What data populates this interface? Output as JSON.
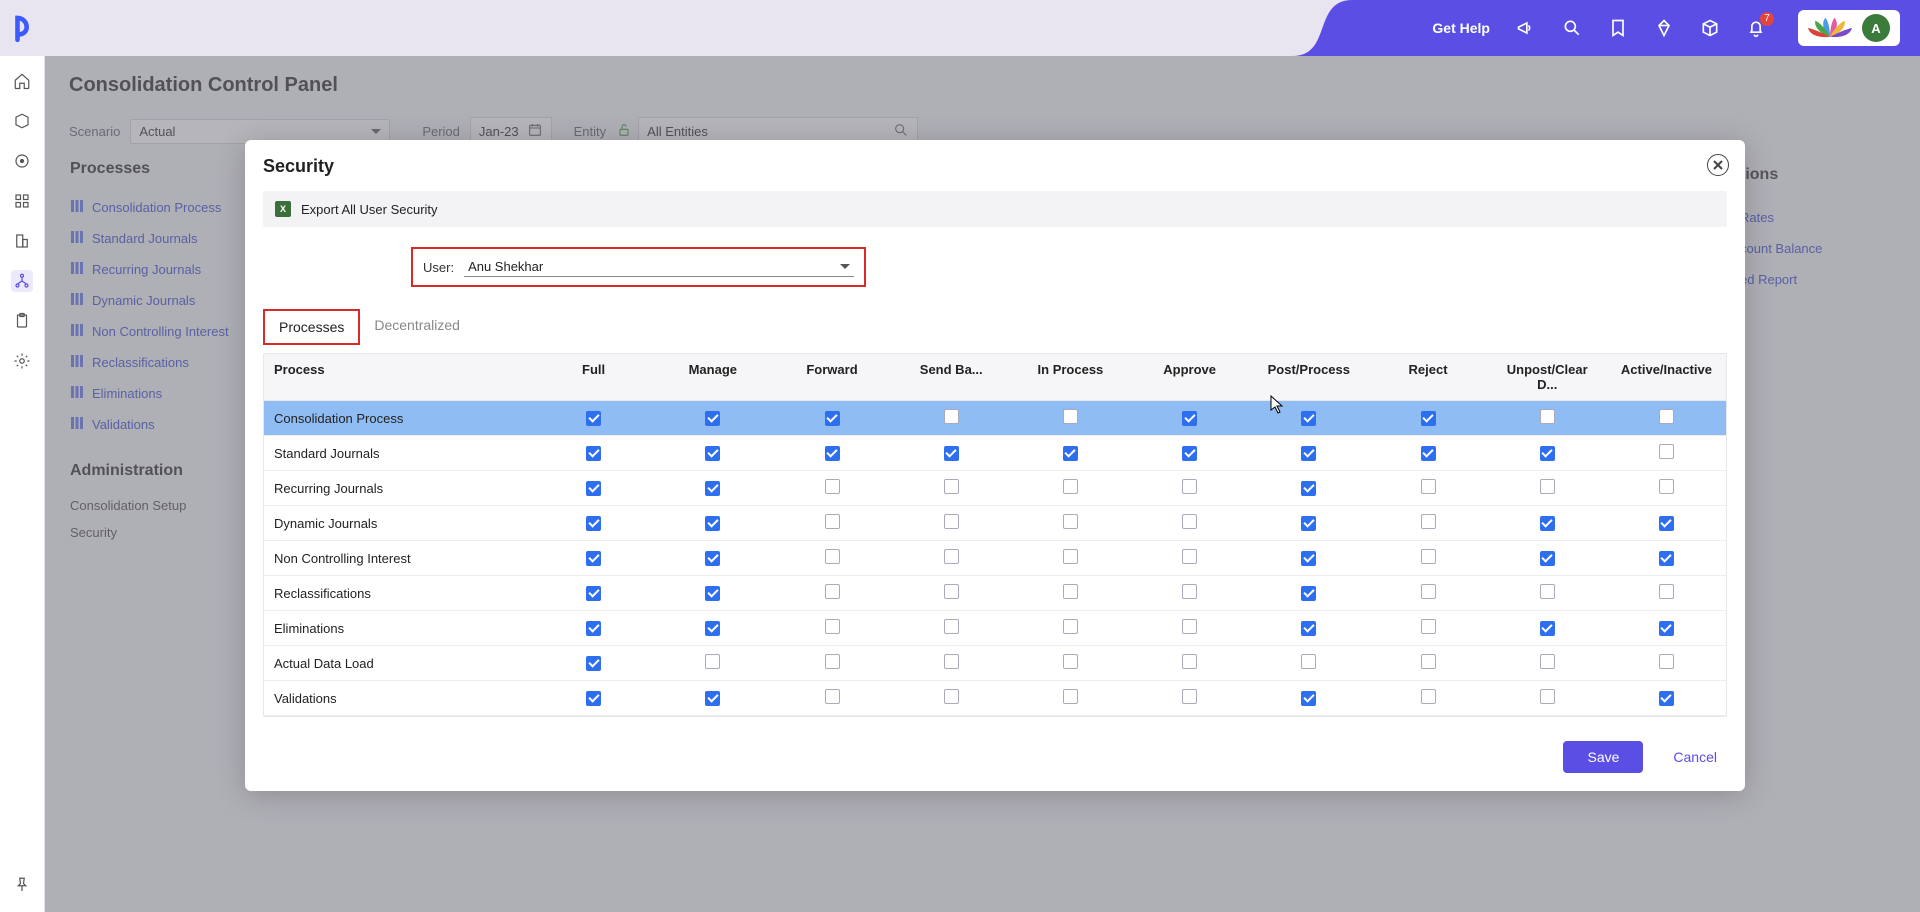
{
  "topbar": {
    "get_help": "Get Help",
    "notif_badge": "7",
    "avatar_initial": "A"
  },
  "page": {
    "title": "Consolidation Control Panel",
    "filters": {
      "scenario_label": "Scenario",
      "scenario_value": "Actual",
      "period_label": "Period",
      "period_value": "Jan-23",
      "entity_label": "Entity",
      "entity_value": "All Entities"
    },
    "processes_header": "Processes",
    "processes": [
      "Consolidation Process",
      "Standard Journals",
      "Recurring Journals",
      "Dynamic Journals",
      "Non Controlling Interest",
      "Reclassifications",
      "Eliminations",
      "Validations"
    ],
    "admin_header": "Administration",
    "admin_items": [
      "Consolidation Setup",
      "Security"
    ],
    "right_header_frag": "tions",
    "right_links": [
      "Rates",
      "count Balance",
      "ed Report"
    ]
  },
  "modal": {
    "title": "Security",
    "export_label": "Export All User Security",
    "user_label": "User:",
    "user_value": "Anu Shekhar",
    "tabs": [
      "Processes",
      "Decentralized"
    ],
    "columns": [
      "Process",
      "Full",
      "Manage",
      "Forward",
      "Send Ba...",
      "In Process",
      "Approve",
      "Post/Process",
      "Reject",
      "Unpost/Clear D...",
      "Active/Inactive"
    ],
    "rows": [
      {
        "name": "Consolidation Process",
        "vals": [
          true,
          true,
          true,
          false,
          false,
          true,
          true,
          true,
          false,
          false
        ],
        "selected": true
      },
      {
        "name": "Standard Journals",
        "vals": [
          true,
          true,
          true,
          true,
          true,
          true,
          true,
          true,
          true,
          false
        ]
      },
      {
        "name": "Recurring Journals",
        "vals": [
          true,
          true,
          false,
          false,
          false,
          false,
          true,
          false,
          false,
          false
        ]
      },
      {
        "name": "Dynamic Journals",
        "vals": [
          true,
          true,
          false,
          false,
          false,
          false,
          true,
          false,
          true,
          true
        ]
      },
      {
        "name": "Non Controlling Interest",
        "vals": [
          true,
          true,
          false,
          false,
          false,
          false,
          true,
          false,
          true,
          true
        ]
      },
      {
        "name": "Reclassifications",
        "vals": [
          true,
          true,
          false,
          false,
          false,
          false,
          true,
          false,
          false,
          false
        ]
      },
      {
        "name": "Eliminations",
        "vals": [
          true,
          true,
          false,
          false,
          false,
          false,
          true,
          false,
          true,
          true
        ]
      },
      {
        "name": "Actual Data Load",
        "vals": [
          true,
          false,
          false,
          false,
          false,
          false,
          false,
          false,
          false,
          false
        ]
      },
      {
        "name": "Validations",
        "vals": [
          true,
          true,
          false,
          false,
          false,
          false,
          true,
          false,
          false,
          true
        ]
      }
    ],
    "save_label": "Save",
    "cancel_label": "Cancel"
  }
}
